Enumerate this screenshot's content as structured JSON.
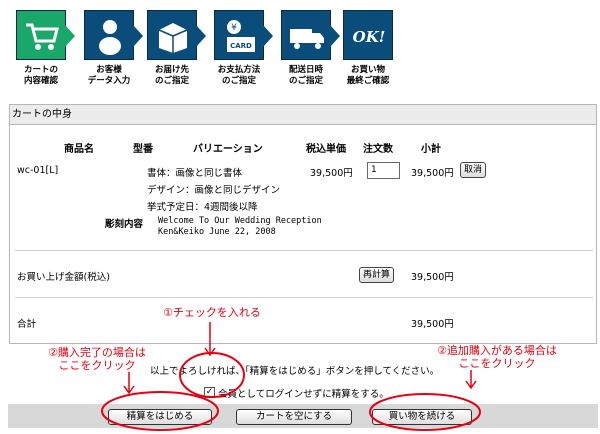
{
  "steps": [
    {
      "icon": "cart-icon",
      "label": "カートの\n内容確認"
    },
    {
      "icon": "customer-icon",
      "label": "お客様\nデータ入力"
    },
    {
      "icon": "delivery-address-icon",
      "label": "お届け先\nのご指定"
    },
    {
      "icon": "payment-card-icon",
      "label": "お支払方法\nのご指定"
    },
    {
      "icon": "delivery-truck-icon",
      "label": "配送日時\nのご指定"
    },
    {
      "icon": "ok-icon",
      "label": "お買い物\n最終ご確認",
      "badge": "OK!"
    }
  ],
  "payment_badge": "CARD",
  "cart": {
    "title": "カートの中身",
    "headers": {
      "product": "商品名",
      "code": "型番",
      "variation": "バリエーション",
      "price": "税込単価",
      "qty": "注文数",
      "subtotal": "小計"
    },
    "item": {
      "product": "wc-01[L]",
      "variation_lines": [
        "書体：画像と同じ書体",
        "デザイン：画像と同じデザイン",
        "挙式予定日：4週間後以降"
      ],
      "price": "39,500円",
      "qty": "1",
      "subtotal": "39,500円",
      "cancel_label": "取消",
      "engraving_label": "彫刻内容",
      "engraving_lines": [
        "Welcome To Our Wedding Reception",
        "Ken&Keiko  June 22, 2008"
      ]
    },
    "total_label": "お買い上げ金額(税込)",
    "recalc_label": "再計算",
    "total_amount": "39,500円",
    "grand_label": "合計",
    "grand_amount": "39,500円"
  },
  "notice": "以上でよろしければ、「精算をはじめる」ボタンを押してください。",
  "checkbox": {
    "checked": true,
    "label": "会員としてログインせずに精算をする。"
  },
  "buttons": {
    "checkout": "精算をはじめる",
    "empty_cart": "カートを空にする",
    "continue": "買い物を続ける"
  },
  "annotations": {
    "check": "①チェックを入れる",
    "complete": "②購入完了の場合は\nここをクリック",
    "additional": "②追加購入がある場合は\nここをクリック"
  },
  "colors": {
    "active_step": "#1aa76a",
    "step": "#0a4d7a",
    "annotation": "#e60012"
  }
}
